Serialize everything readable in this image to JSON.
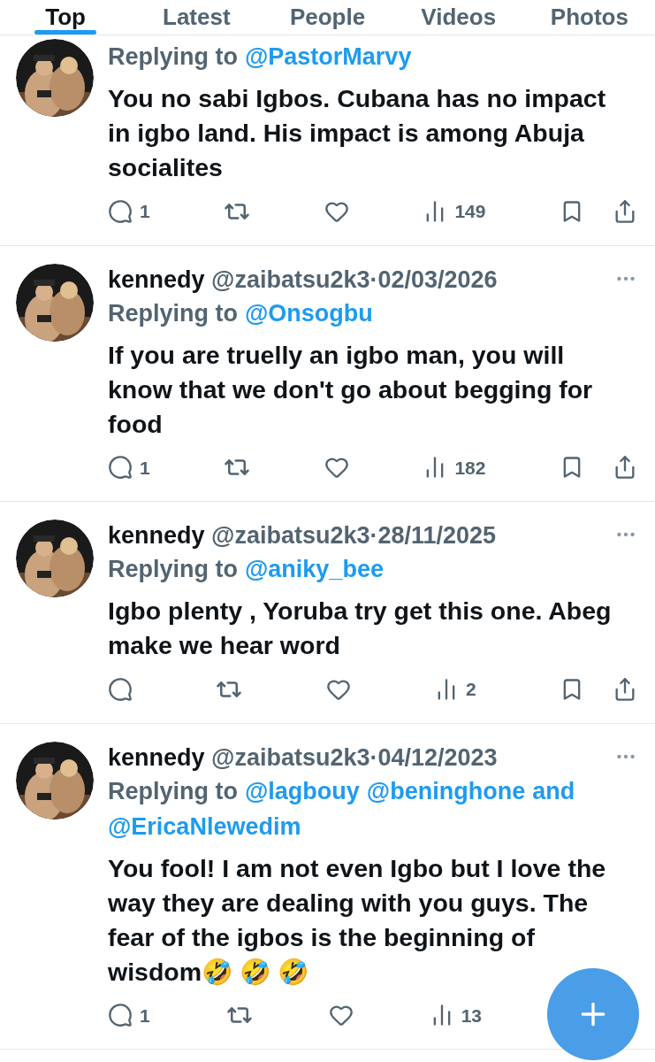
{
  "tabs": [
    {
      "label": "Top",
      "selected": true
    },
    {
      "label": "Latest",
      "selected": false
    },
    {
      "label": "People",
      "selected": false
    },
    {
      "label": "Videos",
      "selected": false
    },
    {
      "label": "Photos",
      "selected": false
    }
  ],
  "tweets": [
    {
      "reply_label": "Replying to",
      "reply_mentions": [
        "@PastorMarvy"
      ],
      "text": "You no sabi Igbos. Cubana has no impact in igbo land. His impact is among Abuja socialites",
      "replies": "1",
      "views": "149",
      "end_actions_visible": true
    },
    {
      "name": "kennedy",
      "handle": "@zaibatsu2k3",
      "separator": "·",
      "date": "02/03/2026",
      "reply_label": "Replying to",
      "reply_mentions": [
        "@Onsogbu"
      ],
      "text": "If you are truelly an igbo man, you will know that we don't go about begging for food",
      "replies": "1",
      "views": "182",
      "end_actions_visible": true
    },
    {
      "name": "kennedy",
      "handle": "@zaibatsu2k3",
      "separator": "·",
      "date": "28/11/2025",
      "reply_label": "Replying to",
      "reply_mentions": [
        "@aniky_bee"
      ],
      "text": "Igbo plenty , Yoruba try get this one. Abeg make we hear word",
      "views": "2",
      "end_actions_visible": true
    },
    {
      "name": "kennedy",
      "handle": "@zaibatsu2k3",
      "separator": "·",
      "date": "04/12/2023",
      "reply_label": "Replying to",
      "reply_mentions": [
        "@lagbouy",
        "@beninghone"
      ],
      "reply_joiner": "and",
      "reply_last_mention": "@EricaNlewedim",
      "text": "You fool! I am not even Igbo but I love the way they are dealing with you guys. The fear of the igbos is the beginning of wisdom🤣 🤣 🤣",
      "replies": "1",
      "views": "13",
      "end_actions_visible": false
    }
  ]
}
